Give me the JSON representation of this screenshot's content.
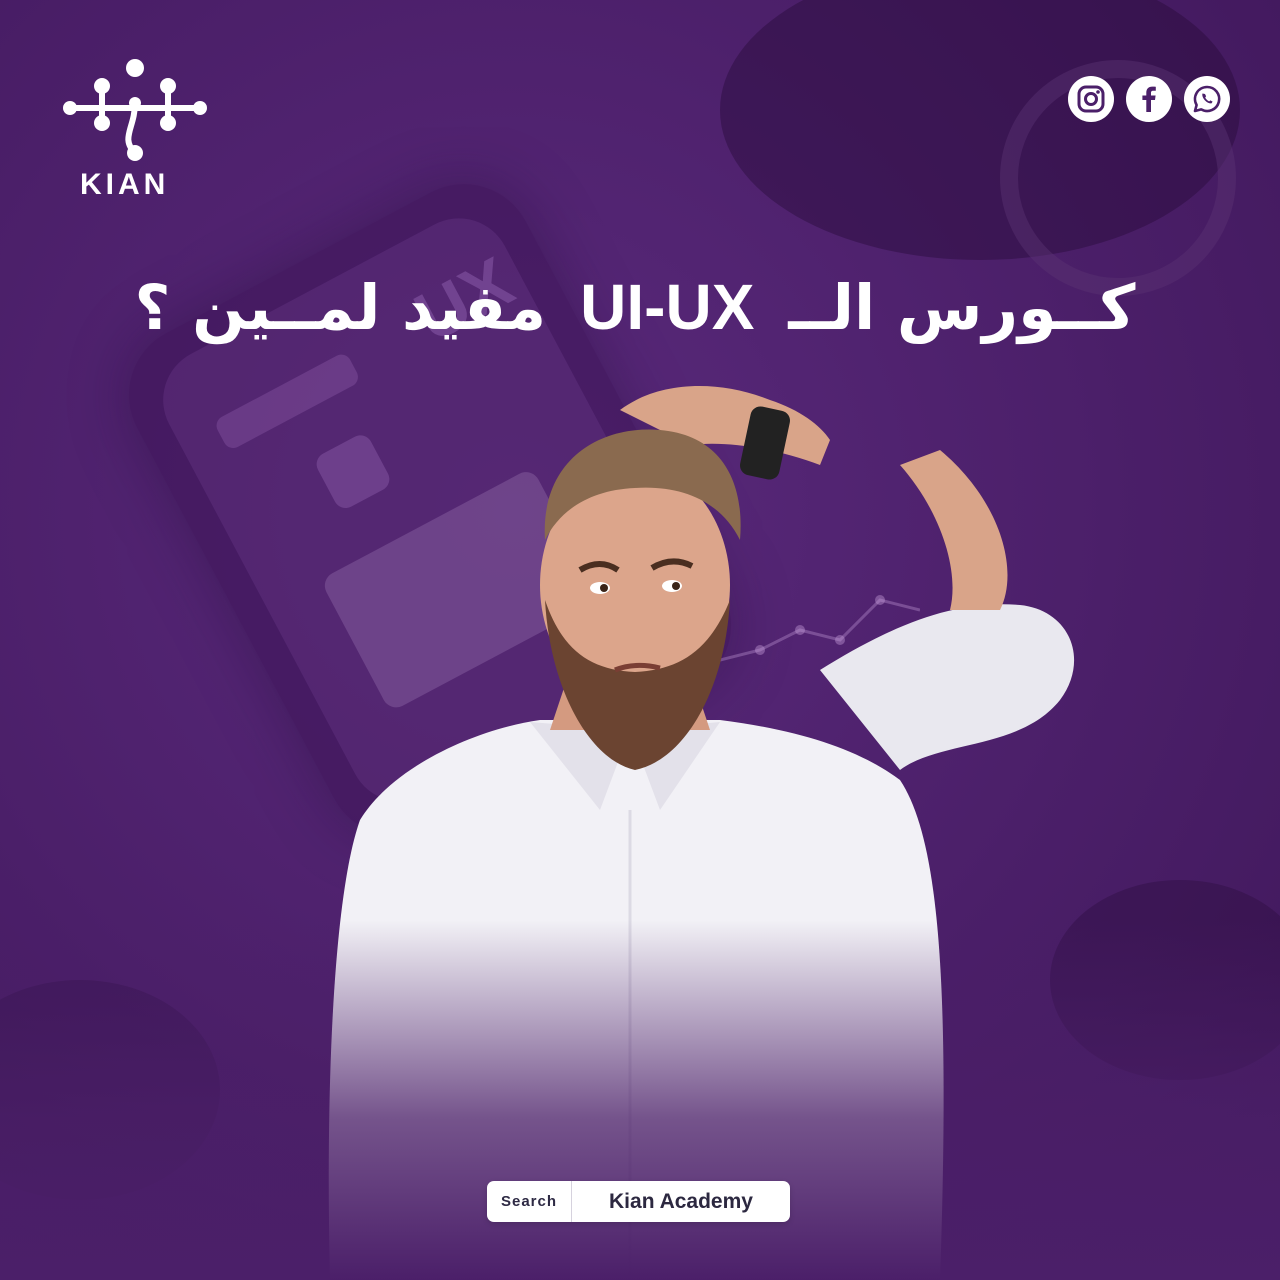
{
  "brand": {
    "name": "KIAN",
    "accent": "#4b1f69"
  },
  "headline": {
    "part1": "كــورس الــ",
    "part2": "UI-UX",
    "part3": "مفيد لمــين ؟"
  },
  "background": {
    "phone_text": "UX"
  },
  "socials": [
    {
      "name": "instagram-icon"
    },
    {
      "name": "facebook-icon"
    },
    {
      "name": "whatsapp-icon"
    }
  ],
  "search": {
    "label": "Search",
    "query": "Kian Academy"
  }
}
